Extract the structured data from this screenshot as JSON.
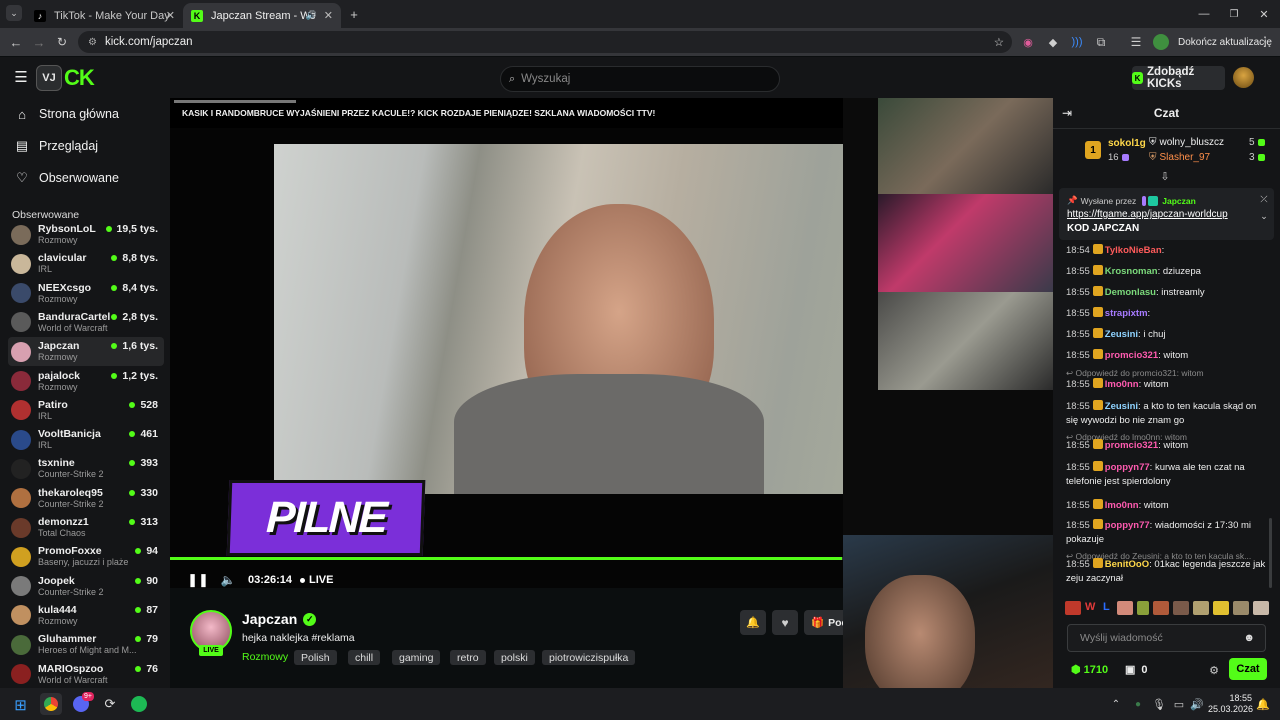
{
  "tabs": [
    {
      "label": "TikTok - Make Your Day"
    },
    {
      "label": "Japczan Stream - Watch Live"
    }
  ],
  "url": "kick.com/japczan",
  "update_button": "Dokończ aktualizację",
  "search_placeholder": "Wyszukaj",
  "get_kicks": "Zdobądź KICKs",
  "nav": {
    "home": "Strona główna",
    "browse": "Przeglądaj",
    "following": "Obserwowane"
  },
  "followed_heading": "Obserwowane",
  "channels": [
    {
      "name": "RybsonLoL",
      "category": "Rozmowy",
      "viewers": "19,5 tys.",
      "color": "#7a6b5a"
    },
    {
      "name": "clavicular",
      "category": "IRL",
      "viewers": "8,8 tys.",
      "color": "#c9b79a"
    },
    {
      "name": "NEEXcsgo",
      "category": "Rozmowy",
      "viewers": "8,4 tys.",
      "color": "#3a4a6a"
    },
    {
      "name": "BanduraCartel",
      "category": "World of Warcraft",
      "viewers": "2,8 tys.",
      "color": "#5a5a5a"
    },
    {
      "name": "Japczan",
      "category": "Rozmowy",
      "viewers": "1,6 tys.",
      "color": "#d8a0b0"
    },
    {
      "name": "pajalock",
      "category": "Rozmowy",
      "viewers": "1,2 tys.",
      "color": "#8a2a3a"
    },
    {
      "name": "Patiro",
      "category": "IRL",
      "viewers": "528",
      "color": "#b03030"
    },
    {
      "name": "VooltBanicja",
      "category": "IRL",
      "viewers": "461",
      "color": "#2a4a8a"
    },
    {
      "name": "tsxnine",
      "category": "Counter-Strike 2",
      "viewers": "393",
      "color": "#222"
    },
    {
      "name": "thekaroleq95",
      "category": "Counter-Strike 2",
      "viewers": "330",
      "color": "#b07040"
    },
    {
      "name": "demonzz1",
      "category": "Total Chaos",
      "viewers": "313",
      "color": "#6a3a2a"
    },
    {
      "name": "PromoFoxxe",
      "category": "Baseny, jacuzzi i plaże",
      "viewers": "94",
      "color": "#d0a020"
    },
    {
      "name": "Joopek",
      "category": "Counter-Strike 2",
      "viewers": "90",
      "color": "#7a7a7a"
    },
    {
      "name": "kula444",
      "category": "Rozmowy",
      "viewers": "87",
      "color": "#c09060"
    },
    {
      "name": "Gluhammer",
      "category": "Heroes of Might and M...",
      "viewers": "79",
      "color": "#4a6a3a"
    },
    {
      "name": "MARIOspzoo",
      "category": "World of Warcraft",
      "viewers": "76",
      "color": "#8a2020"
    }
  ],
  "video": {
    "ticker": "KASIK I RANDOMBRUCE WYJAŚNIENI PRZEZ KACULE!? KICK ROZDAJE PIENIĄDZE! SZKLANA WIADOMOŚCI TTV!",
    "overlay": "PILNE",
    "time": "03:26:14",
    "live": "LIVE",
    "progress": 0.998
  },
  "streamer": {
    "name": "Japczan",
    "title": "hejka naklejka #reklama",
    "category": "Rozmowy",
    "tags": [
      "Polish",
      "chill",
      "gaming",
      "retro",
      "polski",
      "piotrowiczispułka"
    ],
    "live_badge": "LIVE",
    "follow_label": "Pod"
  },
  "chat": {
    "title": "Czat",
    "gifters": [
      {
        "rank": "1",
        "name": "sokol1g",
        "count": "16"
      },
      {
        "name": "wolny_bluszcz",
        "count": "5"
      },
      {
        "name": "Slasher_97",
        "count": "3"
      }
    ],
    "pinned": {
      "label": "Wysłane przez",
      "by": "Japczan",
      "link": "https://ftgame.app/japczan-worldcup",
      "code": "KOD JAPCZAN"
    },
    "messages": [
      {
        "time": "18:54",
        "user": "TylkoNieBan",
        "color": "#ff5b5b",
        "text": ""
      },
      {
        "time": "18:55",
        "user": "Krosnoman",
        "color": "#7bd97b",
        "text": "dziuzepa"
      },
      {
        "time": "18:55",
        "user": "Demonlasu",
        "color": "#7bd97b",
        "text": "instreamly"
      },
      {
        "time": "18:55",
        "user": "strapixtm",
        "color": "#a77bff",
        "text": ""
      },
      {
        "time": "18:55",
        "user": "Zeusini",
        "color": "#8fd3ff",
        "text": "i chuj"
      },
      {
        "time": "18:55",
        "user": "promcio321",
        "color": "#ff5bb0",
        "text": "witom"
      },
      {
        "reply": "Odpowiedź do promcio321: witom",
        "time": "18:55",
        "user": "lmo0nn",
        "color": "#ff5bb0",
        "text": "witom"
      },
      {
        "time": "18:55",
        "user": "Zeusini",
        "color": "#8fd3ff",
        "text": "a kto to ten kacula skąd on się wywodzi bo nie znam go"
      },
      {
        "reply": "Odpowiedź do lmo0nn: witom",
        "time": "18:55",
        "user": "promcio321",
        "color": "#ff5bb0",
        "text": "witom"
      },
      {
        "time": "18:55",
        "user": "poppyn77",
        "color": "#ff5bb0",
        "text": "kurwa ale ten czat na telefonie jest spierdolony"
      },
      {
        "time": "18:55",
        "user": "lmo0nn",
        "color": "#ff5bb0",
        "text": "witom"
      },
      {
        "time": "18:55",
        "user": "poppyn77",
        "color": "#ff5bb0",
        "text": "wiadomości z 17:30 mi pokazuje"
      },
      {
        "reply": "Odpowiedź do Zeusini: a kto to ten kacula sk...",
        "time": "18:55",
        "user": "BenitOoO",
        "color": "#ffd84a",
        "text": "01kac legenda jeszcze jak zeju zaczynał"
      }
    ],
    "input_placeholder": "Wyślij wiadomość",
    "points": "1710",
    "gifts": "0",
    "send": "Czat"
  },
  "taskbar": {
    "time": "18:55",
    "date": "25.03.2026",
    "discord_badge": "9+"
  },
  "colors": {
    "accent": "#53fc18",
    "purple": "#7b2fd9"
  }
}
